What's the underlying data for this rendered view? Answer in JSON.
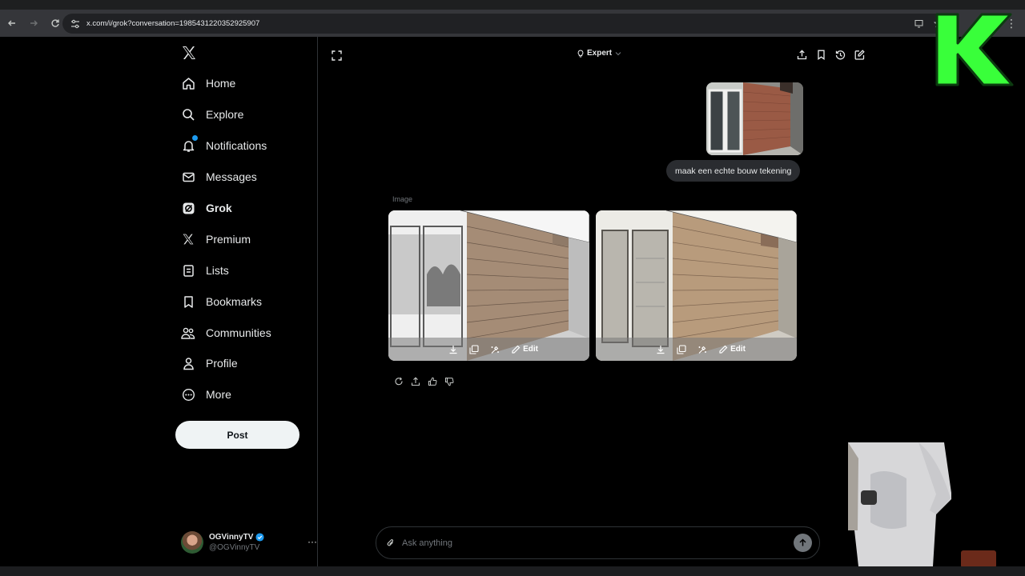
{
  "browser": {
    "url": "x.com/i/grok?conversation=1985431220352925907"
  },
  "sidebar": {
    "items": [
      {
        "label": "Home",
        "icon": "home-icon"
      },
      {
        "label": "Explore",
        "icon": "search-icon"
      },
      {
        "label": "Notifications",
        "icon": "bell-icon"
      },
      {
        "label": "Messages",
        "icon": "mail-icon"
      },
      {
        "label": "Grok",
        "icon": "grok-icon"
      },
      {
        "label": "Premium",
        "icon": "x-logo-icon"
      },
      {
        "label": "Lists",
        "icon": "list-icon"
      },
      {
        "label": "Bookmarks",
        "icon": "bookmark-icon"
      },
      {
        "label": "Communities",
        "icon": "communities-icon"
      },
      {
        "label": "Profile",
        "icon": "person-icon"
      },
      {
        "label": "More",
        "icon": "more-circle-icon"
      }
    ],
    "post_label": "Post",
    "account": {
      "name": "OGVinnyTV",
      "handle": "@OGVinnyTV"
    }
  },
  "header": {
    "mode": "Expert"
  },
  "conversation": {
    "user_message": "maak een echte bouw tekening",
    "image_label": "Image",
    "edit_label": "Edit"
  },
  "composer": {
    "placeholder": "Ask anything"
  },
  "colors": {
    "accent": "#1d9bf0",
    "k_logo": "#39ff3a"
  }
}
